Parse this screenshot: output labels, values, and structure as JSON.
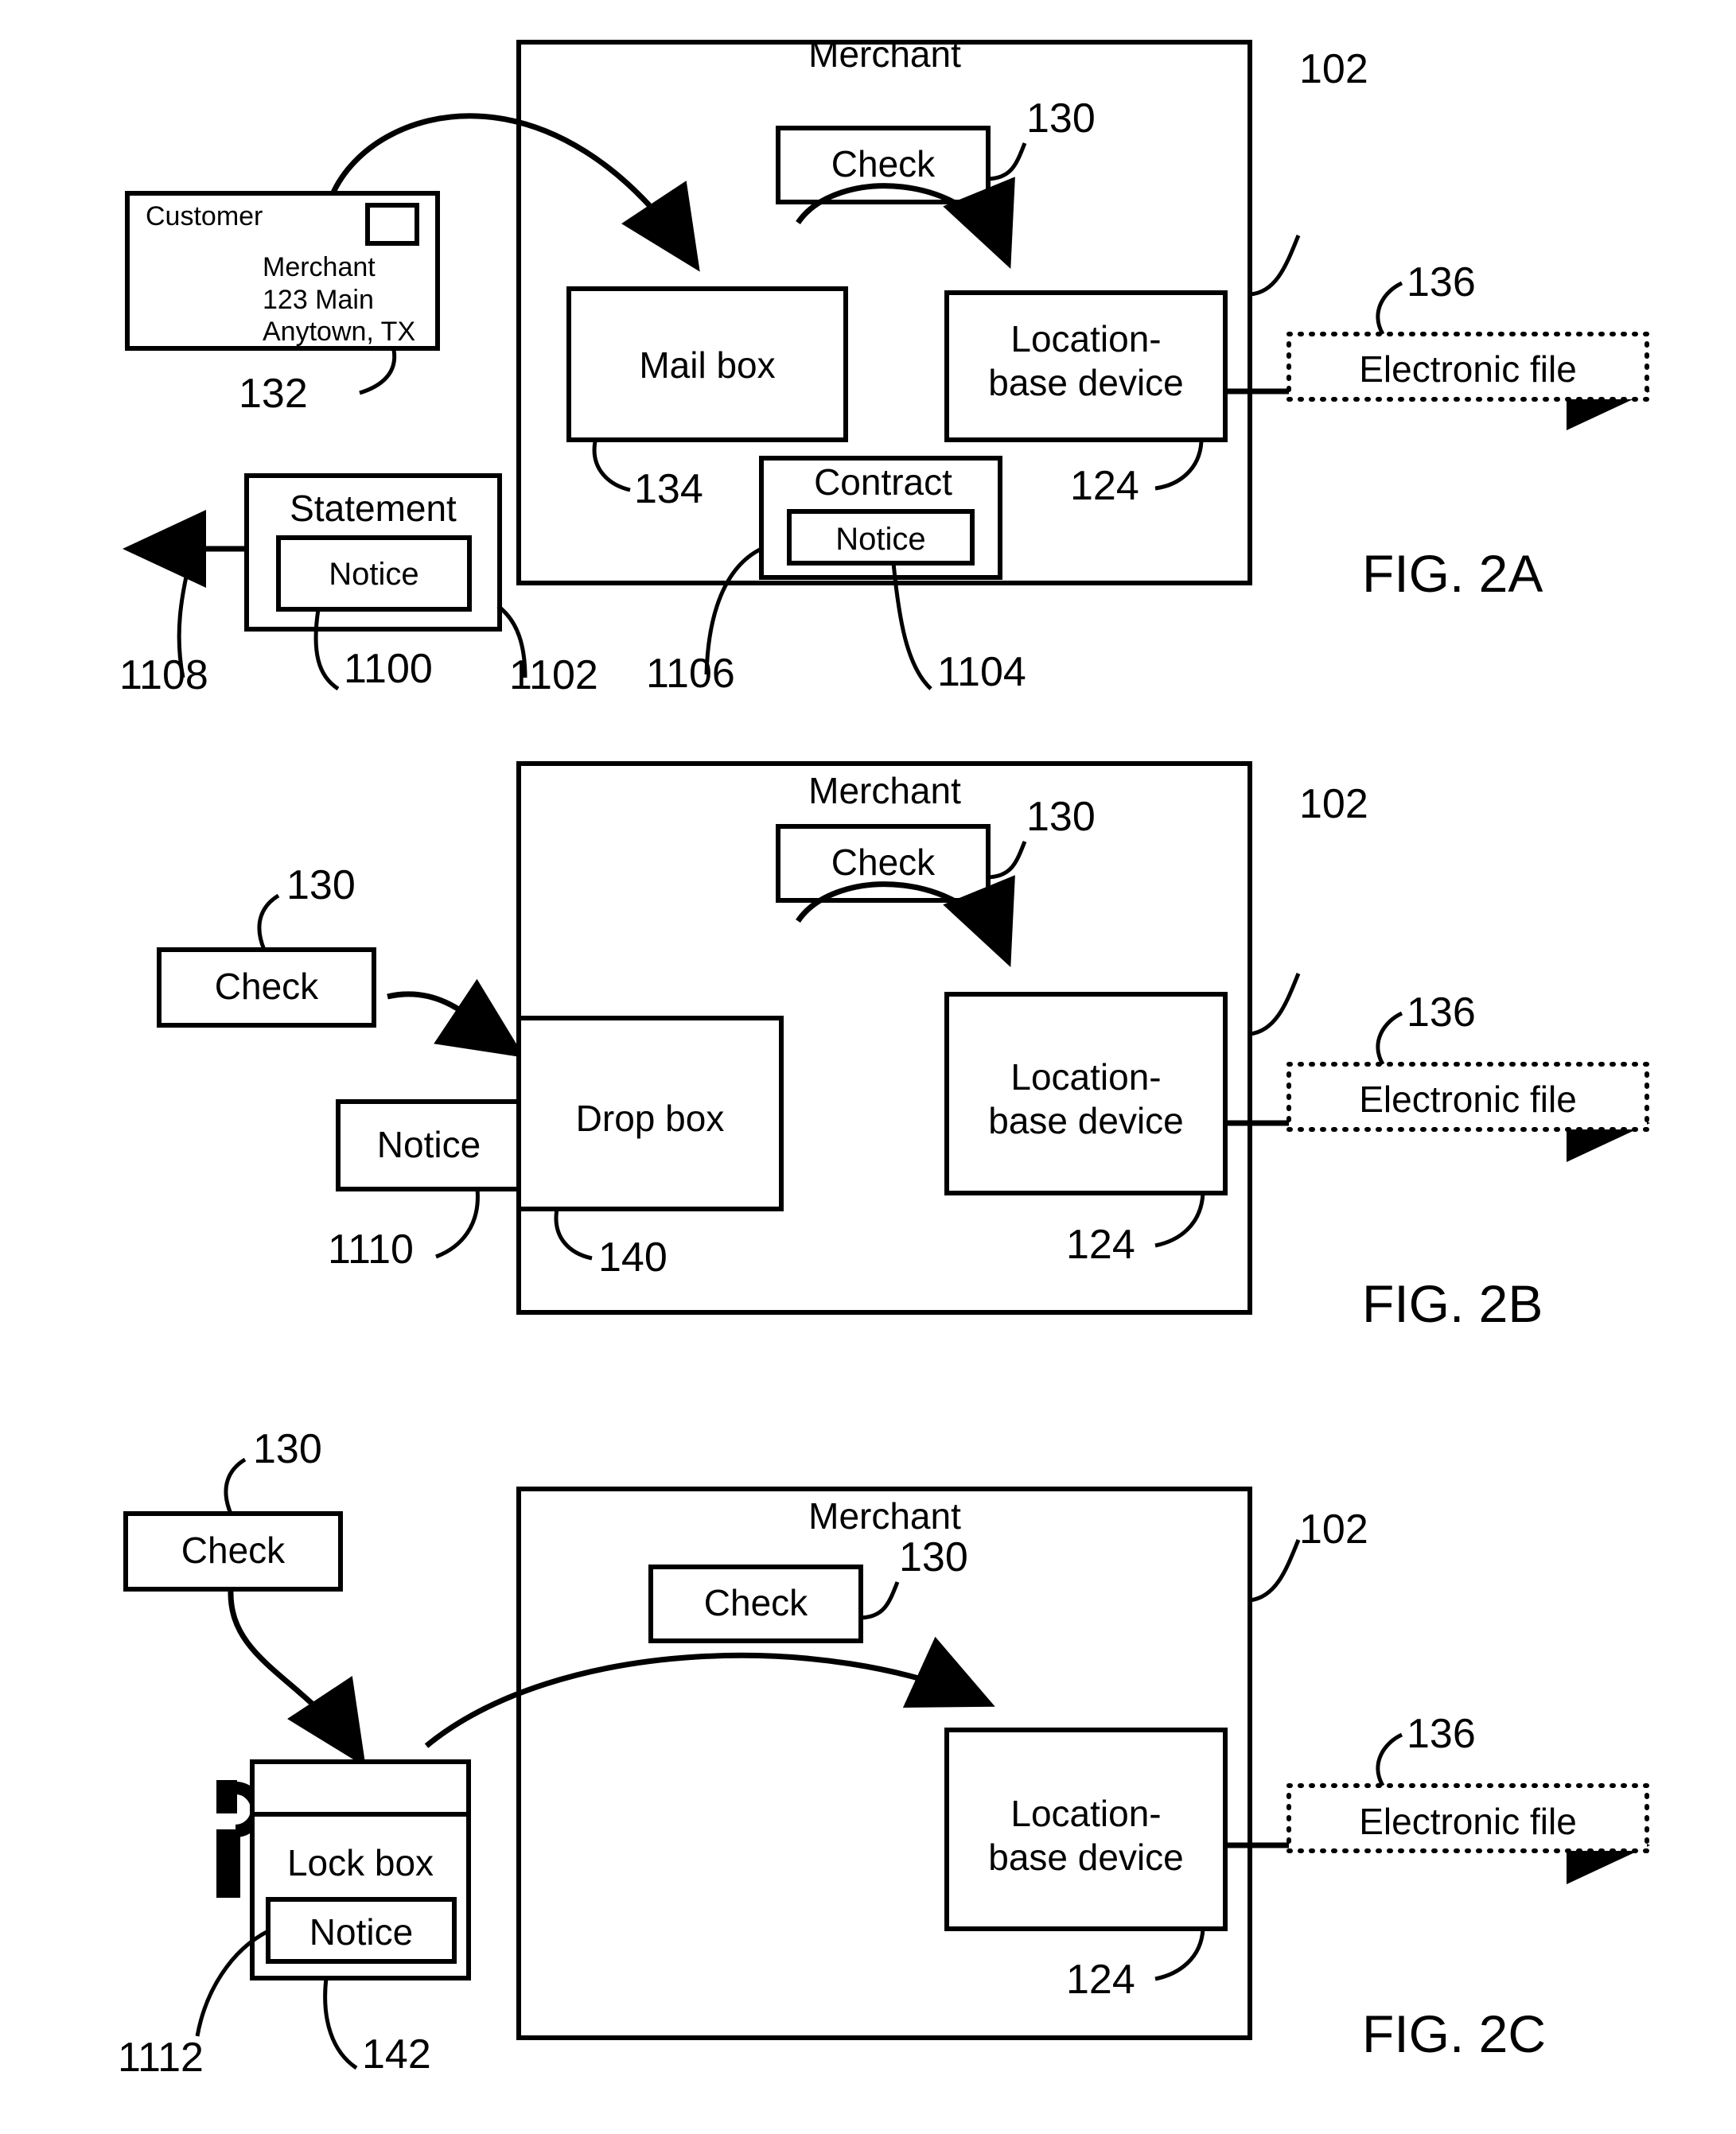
{
  "document": {
    "type": "patent-drawing-sheet",
    "figures": [
      "FIG. 2A",
      "FIG. 2B",
      "FIG. 2C"
    ]
  },
  "fig2a": {
    "caption": "FIG. 2A",
    "merchant_label": "Merchant",
    "merchant_ref": "102",
    "envelope": {
      "from": "Customer",
      "addr_line1": "Merchant",
      "addr_line2": "123 Main",
      "addr_line3": "Anytown, TX",
      "ref": "132"
    },
    "check": {
      "label": "Check",
      "ref": "130"
    },
    "mailbox": {
      "label": "Mail box",
      "ref": "134"
    },
    "location_device": {
      "line1": "Location-",
      "line2": "base device",
      "ref": "124"
    },
    "electronic_file": {
      "label": "Electronic file",
      "ref": "136"
    },
    "statement": {
      "label": "Statement",
      "ref": "1102"
    },
    "statement_notice": {
      "label": "Notice",
      "ref": "1100"
    },
    "statement_out_ref": "1108",
    "contract": {
      "label": "Contract",
      "ref": "1106"
    },
    "contract_notice": {
      "label": "Notice",
      "ref": "1104"
    }
  },
  "fig2b": {
    "caption": "FIG. 2B",
    "merchant_label": "Merchant",
    "merchant_ref": "102",
    "check_inside": {
      "label": "Check",
      "ref": "130"
    },
    "check_outside": {
      "label": "Check",
      "ref": "130"
    },
    "notice": {
      "label": "Notice",
      "ref": "1110"
    },
    "dropbox": {
      "label": "Drop box",
      "ref": "140"
    },
    "location_device": {
      "line1": "Location-",
      "line2": "base device",
      "ref": "124"
    },
    "electronic_file": {
      "label": "Electronic file",
      "ref": "136"
    }
  },
  "fig2c": {
    "caption": "FIG. 2C",
    "merchant_label": "Merchant",
    "merchant_ref": "102",
    "check_inside": {
      "label": "Check",
      "ref": "130"
    },
    "check_outside": {
      "label": "Check",
      "ref": "130"
    },
    "lockbox": {
      "label": "Lock box",
      "ref": "1112"
    },
    "lockbox_notice": {
      "label": "Notice",
      "ref": "142"
    },
    "location_device": {
      "line1": "Location-",
      "line2": "base device",
      "ref": "124"
    },
    "electronic_file": {
      "label": "Electronic file",
      "ref": "136"
    }
  }
}
